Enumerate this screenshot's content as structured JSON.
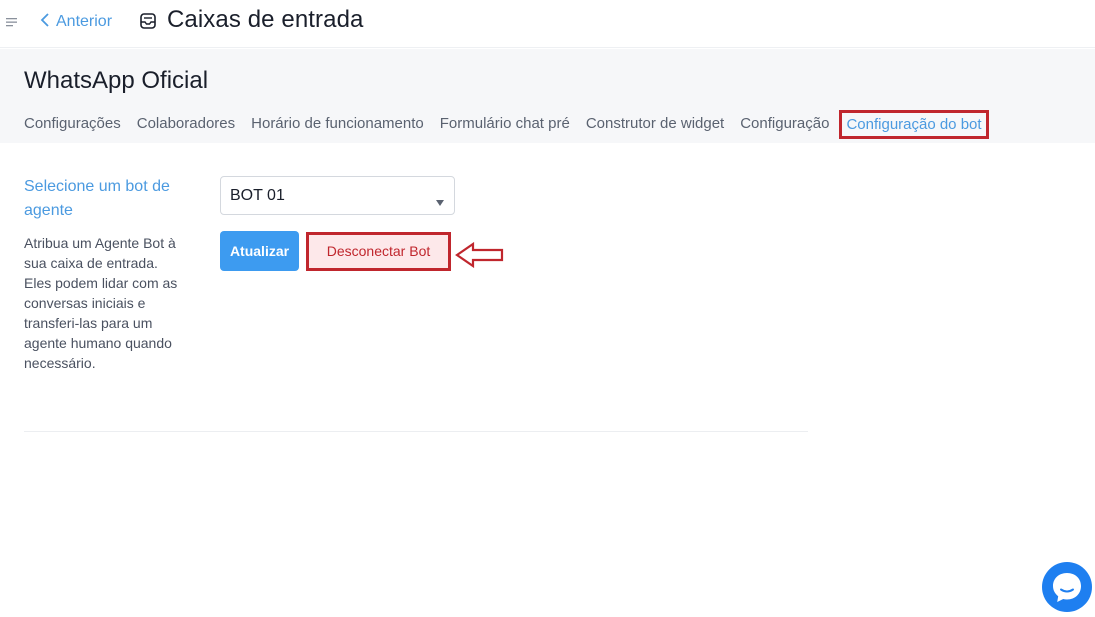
{
  "header": {
    "back_label": "Anterior",
    "title": "Caixas de entrada"
  },
  "inbox": {
    "name": "WhatsApp Oficial"
  },
  "tabs": [
    {
      "label": "Configurações"
    },
    {
      "label": "Colaboradores"
    },
    {
      "label": "Horário de funcionamento"
    },
    {
      "label": "Formulário chat pré"
    },
    {
      "label": "Construtor de widget"
    },
    {
      "label": "Configuração"
    },
    {
      "label": "Configuração do bot",
      "active": true
    }
  ],
  "bot_section": {
    "title": "Selecione um bot de agente",
    "description": "Atribua um Agente Bot à sua caixa de entrada. Eles podem lidar com as conversas iniciais e transferi-las para um agente humano quando necessário.",
    "selected_bot": "BOT 01",
    "update_label": "Atualizar",
    "disconnect_label": "Desconectar Bot"
  },
  "colors": {
    "accent": "#4b9ae0",
    "primary_button": "#3d9bf0",
    "annotation_red": "#c0262d",
    "chat_bubble": "#1e7ff0"
  },
  "icons": [
    "menu-icon",
    "chevron-left-icon",
    "inbox-icon",
    "caret-down-icon",
    "arrow-annotation-icon",
    "chat-icon"
  ]
}
